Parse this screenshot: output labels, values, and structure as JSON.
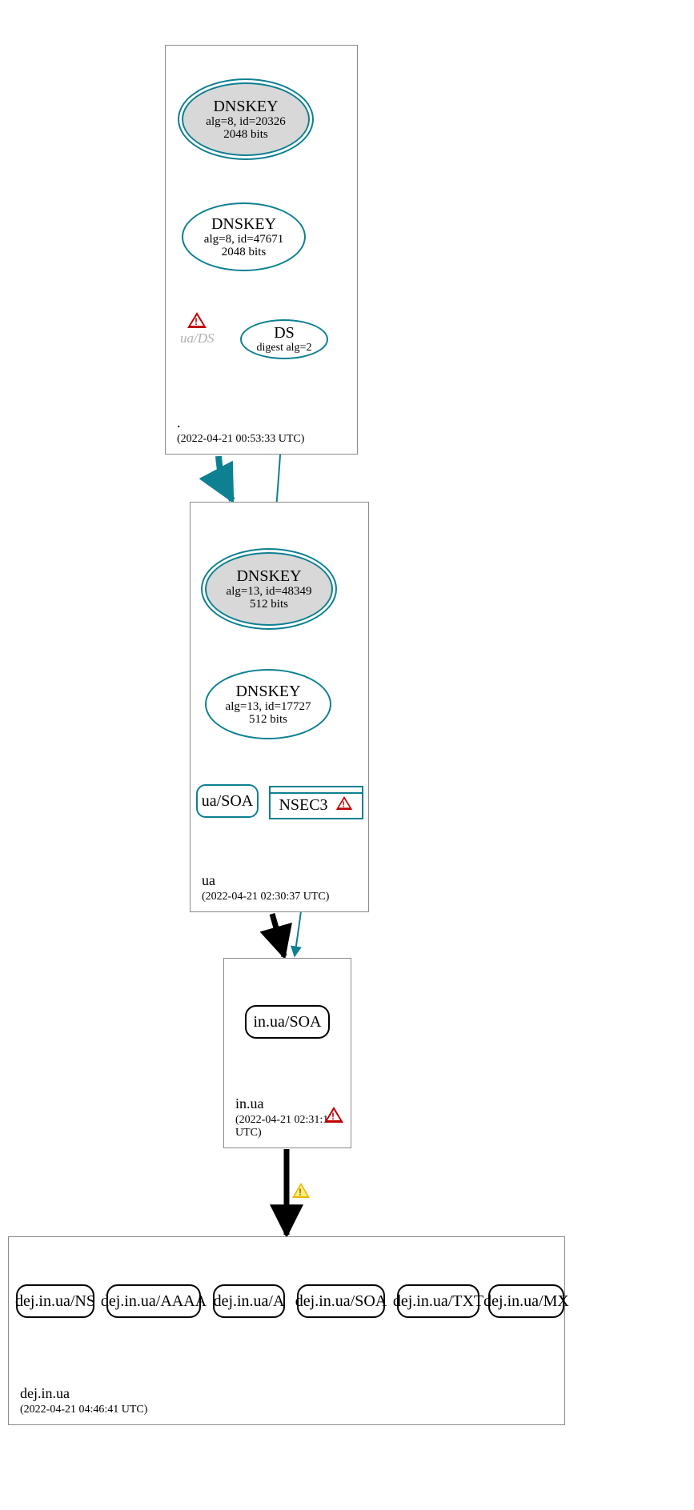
{
  "zones": {
    "root": {
      "label": ".",
      "timestamp": "(2022-04-21 00:53:33 UTC)",
      "ksk": {
        "title": "DNSKEY",
        "alg": "alg=8, id=20326",
        "bits": "2048 bits"
      },
      "zsk": {
        "title": "DNSKEY",
        "alg": "alg=8, id=47671",
        "bits": "2048 bits"
      },
      "ds": {
        "title": "DS",
        "digest": "digest alg=2"
      },
      "ds_warning_note": "ua/DS"
    },
    "ua": {
      "label": "ua",
      "timestamp": "(2022-04-21 02:30:37 UTC)",
      "ksk": {
        "title": "DNSKEY",
        "alg": "alg=13, id=48349",
        "bits": "512 bits"
      },
      "zsk": {
        "title": "DNSKEY",
        "alg": "alg=13, id=17727",
        "bits": "512 bits"
      },
      "soa": "ua/SOA",
      "nsec3": "NSEC3"
    },
    "in_ua": {
      "label": "in.ua",
      "timestamp": "(2022-04-21 02:31:18 UTC)",
      "soa": "in.ua/SOA"
    },
    "dej_in_ua": {
      "label": "dej.in.ua",
      "timestamp": "(2022-04-21 04:46:41 UTC)",
      "records": [
        "dej.in.ua/NS",
        "dej.in.ua/AAAA",
        "dej.in.ua/A",
        "dej.in.ua/SOA",
        "dej.in.ua/TXT",
        "dej.in.ua/MX"
      ]
    }
  },
  "colors": {
    "teal": "#0d8091",
    "error": "#c00000",
    "warn": "#e6b800"
  }
}
